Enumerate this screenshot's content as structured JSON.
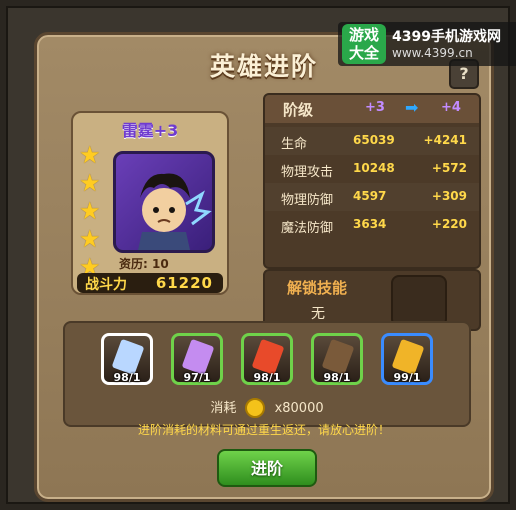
{
  "title": "英雄进阶",
  "help_label": "?",
  "watermark": {
    "logo": "游戏大全",
    "name": "4399手机游戏网",
    "url": "www.4399.cn"
  },
  "hero": {
    "name": "雷霆+3",
    "stars": 5,
    "resume_label": "资历:",
    "resume_value": "10",
    "power_label": "战斗力",
    "power_value": "61220"
  },
  "stats": {
    "title": "阶级",
    "from": "+3",
    "to": "+4",
    "rows": [
      {
        "label": "生命",
        "value": "65039",
        "bonus": "+4241"
      },
      {
        "label": "物理攻击",
        "value": "10248",
        "bonus": "+572"
      },
      {
        "label": "物理防御",
        "value": "4597",
        "bonus": "+309"
      },
      {
        "label": "魔法防御",
        "value": "3634",
        "bonus": "+220"
      }
    ]
  },
  "unlock": {
    "title": "解锁技能",
    "value": "无"
  },
  "materials": [
    {
      "count": "98/1",
      "border": "#ffffff",
      "gem": "#b9d7ff"
    },
    {
      "count": "97/1",
      "border": "#6fd24a",
      "gem": "#c48cf0"
    },
    {
      "count": "98/1",
      "border": "#6fd24a",
      "gem": "#e84a2a"
    },
    {
      "count": "98/1",
      "border": "#6fd24a",
      "gem": "#7a5a3a"
    },
    {
      "count": "99/1",
      "border": "#3a8cff",
      "gem": "#f0b428"
    }
  ],
  "cost": {
    "label": "消耗",
    "value": "x80000"
  },
  "note": "进阶消耗的材料可通过重生返还，请放心进阶！",
  "button": "进阶",
  "colors": {
    "accent_purple": "#c28bff",
    "gold": "#ffd84a",
    "button_green": "#4cb432"
  }
}
